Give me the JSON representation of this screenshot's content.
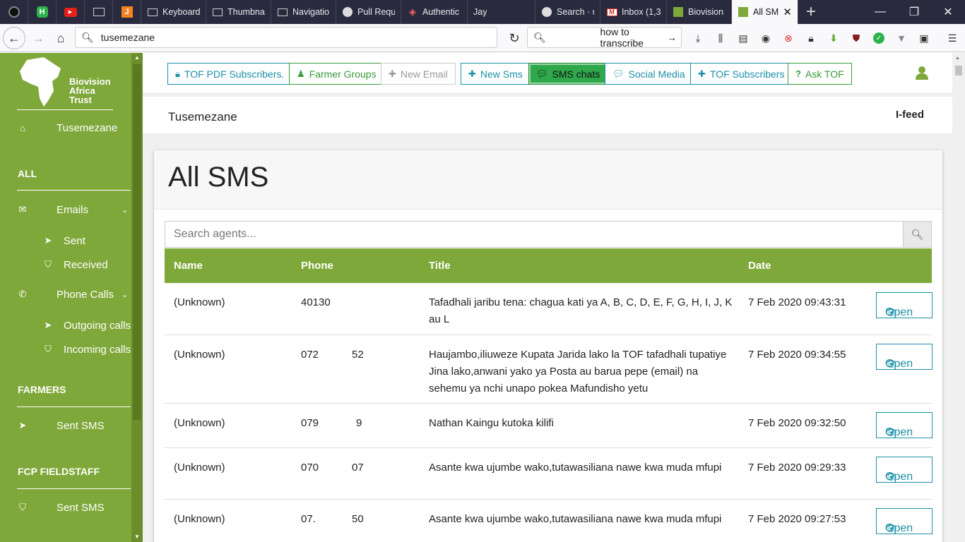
{
  "browser": {
    "tabs": [
      {
        "label": "",
        "icon": "obs-icon"
      },
      {
        "label": "",
        "icon": "h-icon"
      },
      {
        "label": "",
        "icon": "youtube-icon"
      },
      {
        "label": "",
        "icon": "monitor-icon"
      },
      {
        "label": "",
        "icon": "j-icon"
      },
      {
        "label": "Keyboard",
        "icon": "monitor-icon"
      },
      {
        "label": "Thumbna",
        "icon": "monitor-icon"
      },
      {
        "label": "Navigatio",
        "icon": "monitor-icon"
      },
      {
        "label": "Pull Requ",
        "icon": "github-icon"
      },
      {
        "label": "Authentic",
        "icon": "laravel-icon"
      },
      {
        "label": "Jay",
        "icon": ""
      },
      {
        "label": "Search · u",
        "icon": "github-icon"
      },
      {
        "label": "Inbox (1,3",
        "icon": "gmail-icon"
      },
      {
        "label": "Biovision",
        "icon": "biovision-icon"
      },
      {
        "label": "All SM",
        "icon": "biovision-icon"
      }
    ],
    "url": "tusemezane",
    "search_value": "how to transcribe"
  },
  "sidebar": {
    "logo_text": [
      "Biovision",
      "Africa",
      "Trust"
    ],
    "home_label": "Tusemezane",
    "section_all": "ALL",
    "emails_label": "Emails",
    "sent_label": "Sent",
    "received_label": "Received",
    "phone_label": "Phone Calls",
    "outgoing_label": "Outgoing calls",
    "incoming_label": "Incoming calls",
    "section_farmers": "FARMERS",
    "farmers_sent_sms": "Sent SMS",
    "section_fcp": "FCP FIELDSTAFF",
    "fcp_sent_sms": "Sent SMS"
  },
  "topnav": {
    "buttons": [
      {
        "label": "TOF PDF Subscribers."
      },
      {
        "label": "Farmer Groups"
      },
      {
        "label": "New Email"
      },
      {
        "label": "New Sms"
      },
      {
        "label": "SMS chats"
      },
      {
        "label": "Social Media"
      },
      {
        "label": "TOF Subscribers"
      },
      {
        "label": "Ask TOF"
      }
    ]
  },
  "subheader": {
    "title": "Tusemezane",
    "right": "I-feed"
  },
  "card": {
    "title": "All SMS",
    "search_placeholder": "Search agents..."
  },
  "table": {
    "columns": [
      "Name",
      "Phone",
      "Title",
      "Date"
    ],
    "action_label": "Open",
    "rows": [
      {
        "name": "(Unknown)",
        "phone_a": "40130",
        "phone_b": "",
        "title": "Tafadhali jaribu tena: chagua kati ya A, B, C, D, E, F, G, H, I, J, K au L",
        "date": "7 Feb 2020 09:43:31"
      },
      {
        "name": "(Unknown)",
        "phone_a": "072",
        "phone_b": "52",
        "title": "Haujambo,iliuweze Kupata Jarida lako la TOF tafadhali tupatiye Jina lako,anwani yako ya Posta au barua pepe (email) na sehemu ya nchi unapo pokea Mafundisho yetu",
        "date": "7 Feb 2020 09:34:55"
      },
      {
        "name": "(Unknown)",
        "phone_a": "079",
        "phone_b": "9",
        "title": "Nathan Kaingu kutoka kilifi",
        "date": "7 Feb 2020 09:32:50"
      },
      {
        "name": "(Unknown)",
        "phone_a": "070",
        "phone_b": "07",
        "title": "Asante kwa ujumbe wako,tutawasiliana nawe kwa muda mfupi",
        "date": "7 Feb 2020 09:29:33"
      },
      {
        "name": "(Unknown)",
        "phone_a": "07.",
        "phone_b": "50",
        "title": "Asante kwa ujumbe wako,tutawasiliana nawe kwa muda mfupi",
        "date": "7 Feb 2020 09:27:53"
      }
    ]
  },
  "colors": {
    "brand_green": "#7fa83a",
    "teal": "#1b8fa8",
    "active_green": "#2ea84a"
  }
}
